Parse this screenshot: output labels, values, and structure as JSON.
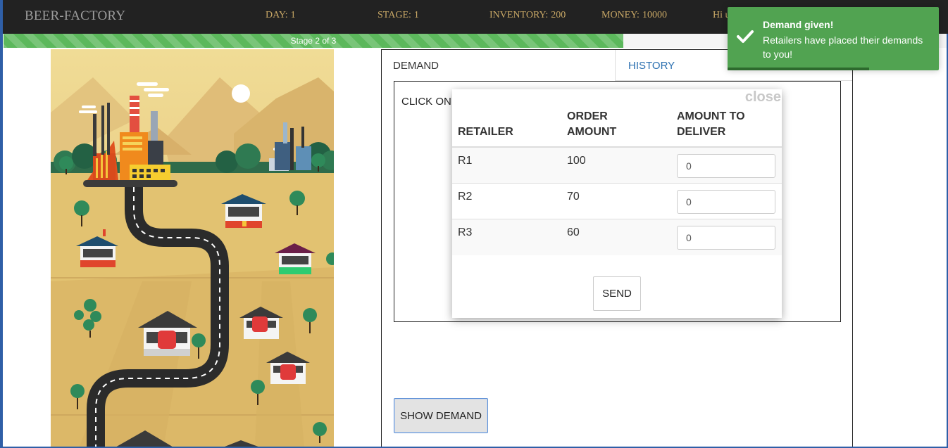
{
  "navbar": {
    "brand": "BEER-FACTORY",
    "day_label": "DAY:",
    "day_value": "1",
    "stage_label": "STAGE:",
    "stage_value": "1",
    "inventory_label": "INVENTORY:",
    "inventory_value": "200",
    "money_label": "MONEY:",
    "money_value": "10000",
    "greeting": "Hi u"
  },
  "progress": {
    "label": "Stage 2 of 3",
    "fraction": 0.6567,
    "color": "#5cb85c"
  },
  "tabs": {
    "demand": "DEMAND",
    "history": "HISTORY"
  },
  "content": {
    "instruction": "CLICK ON",
    "show_demand_button": "SHOW DEMAND"
  },
  "modal": {
    "close_label": "close",
    "headers": [
      "RETAILER",
      "ORDER AMOUNT",
      "AMOUNT TO DELIVER"
    ],
    "rows": [
      {
        "retailer": "R1",
        "order_amount": "100",
        "deliver_value": "0"
      },
      {
        "retailer": "R2",
        "order_amount": "70",
        "deliver_value": "0"
      },
      {
        "retailer": "R3",
        "order_amount": "60",
        "deliver_value": "0"
      }
    ],
    "send_label": "SEND"
  },
  "toast": {
    "title": "Demand given!",
    "message": "Retailers have placed their demands to you!",
    "color": "#51a351",
    "icon": "check-icon",
    "remaining_fraction": 0.67
  },
  "colors": {
    "navbar": "#222222",
    "stat_text": "#c9a866",
    "link": "#2a6fb0"
  }
}
